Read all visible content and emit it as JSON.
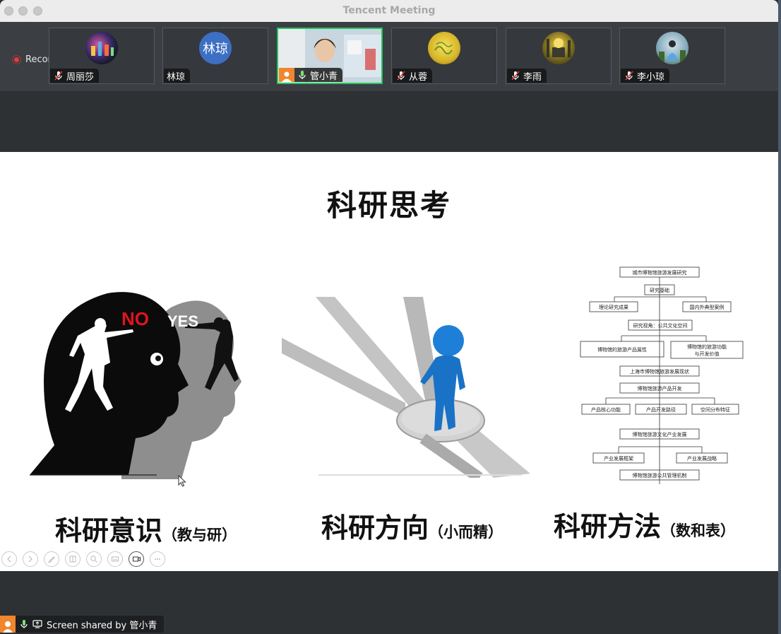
{
  "window": {
    "title": "Tencent Meeting"
  },
  "recording": {
    "label": "Recording"
  },
  "participants": [
    {
      "name": "周丽莎",
      "muted": true
    },
    {
      "name": "林琼",
      "muted": false,
      "initials": "林琼",
      "avatar_color": "#3d6fc4"
    },
    {
      "name": "管小青",
      "muted": false,
      "active": true
    },
    {
      "name": "从蓉",
      "muted": true
    },
    {
      "name": "李雨",
      "muted": true
    },
    {
      "name": "李小琼",
      "muted": true
    }
  ],
  "slide": {
    "title": "科研思考",
    "captions": [
      {
        "main": "科研意识",
        "sub": "（教与研）"
      },
      {
        "main": "科研方向",
        "sub": "（小而精）"
      },
      {
        "main": "科研方法",
        "sub": "（数和表）"
      }
    ],
    "image_texts": {
      "no": "NO",
      "yes": "YES"
    },
    "flowchart": [
      "城市博物馆旅游发展研究",
      "研究基础",
      "理论研究成果",
      "国内外典型案例",
      "研究视角：公共文化空间",
      "博物馆的旅游产品属性",
      "博物馆的旅游功能",
      "与开发价值",
      "上海市博物馆旅游发展现状",
      "博物馆旅游产品开发",
      "产品核心功能",
      "产品开发路径",
      "空间分布特征",
      "博物馆旅游文化产业发展",
      "产业发展框架",
      "产业发展战略",
      "博物馆旅游公共管理机制"
    ]
  },
  "share": {
    "label": "Screen shared by 管小青"
  },
  "colors": {
    "active_border": "#22c55e",
    "recording_red": "#e23b3b",
    "share_user": "#f0862d"
  }
}
